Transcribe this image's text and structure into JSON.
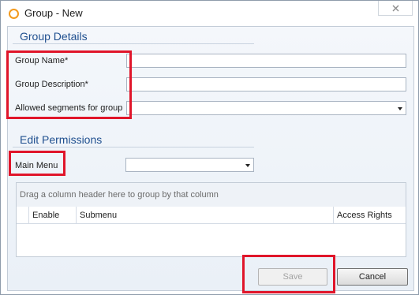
{
  "window": {
    "title": "Group - New",
    "icon": "circle-icon",
    "close": "close-icon"
  },
  "group_details": {
    "title": "Group Details",
    "name_label": "Group Name*",
    "name_value": "",
    "description_label": "Group Description*",
    "description_value": "",
    "segments_label": "Allowed segments for group",
    "segments_value": ""
  },
  "permissions": {
    "title": "Edit Permissions",
    "main_menu_label": "Main Menu",
    "main_menu_value": "",
    "grid": {
      "group_hint": "Drag a column header here to group by that column",
      "columns": [
        "Enable",
        "Submenu",
        "Access Rights"
      ],
      "rows": []
    }
  },
  "buttons": {
    "save": "Save",
    "cancel": "Cancel"
  },
  "colors": {
    "highlight": "#e0152a",
    "section_title": "#1f4f8f",
    "icon": "#f39a1d"
  }
}
